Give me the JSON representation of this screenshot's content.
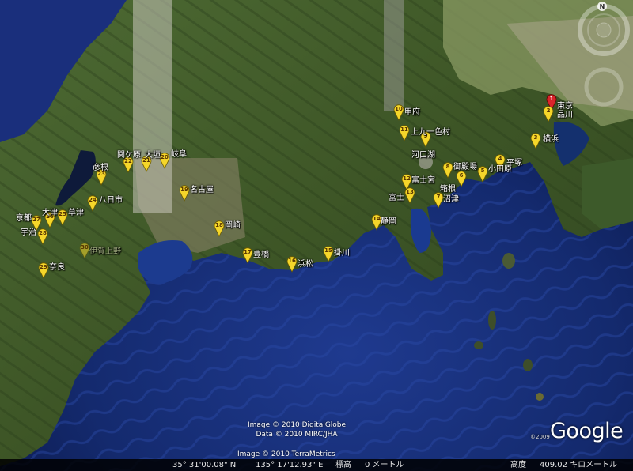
{
  "markers": [
    {
      "num": "1",
      "label": "東京",
      "color": "red"
    },
    {
      "num": "2",
      "label": "品川",
      "color": "yellow"
    },
    {
      "num": "3",
      "label": "横浜",
      "color": "yellow"
    },
    {
      "num": "4",
      "label": "平塚",
      "color": "yellow"
    },
    {
      "num": "5",
      "label": "小田原",
      "color": "yellow"
    },
    {
      "num": "6",
      "label": "箱根",
      "color": "yellow"
    },
    {
      "num": "7",
      "label": "沼津",
      "color": "yellow"
    },
    {
      "num": "8",
      "label": "御殿場",
      "color": "yellow"
    },
    {
      "num": "9",
      "label": "河口湖",
      "color": "yellow"
    },
    {
      "num": "10",
      "label": "甲府",
      "color": "yellow"
    },
    {
      "num": "11",
      "label": "上九一色村",
      "color": "yellow"
    },
    {
      "num": "12",
      "label": "富士宮",
      "color": "yellow"
    },
    {
      "num": "13",
      "label": "富士",
      "color": "yellow"
    },
    {
      "num": "14",
      "label": "静岡",
      "color": "yellow"
    },
    {
      "num": "15",
      "label": "掛川",
      "color": "yellow"
    },
    {
      "num": "16",
      "label": "浜松",
      "color": "yellow"
    },
    {
      "num": "17",
      "label": "豊橋",
      "color": "yellow"
    },
    {
      "num": "18",
      "label": "岡崎",
      "color": "yellow"
    },
    {
      "num": "19",
      "label": "名古屋",
      "color": "yellow"
    },
    {
      "num": "20",
      "label": "岐阜",
      "color": "yellow"
    },
    {
      "num": "21",
      "label": "大垣",
      "color": "yellow"
    },
    {
      "num": "22",
      "label": "関ケ原",
      "color": "yellow"
    },
    {
      "num": "23",
      "label": "彦根",
      "color": "yellow"
    },
    {
      "num": "24",
      "label": "八日市",
      "color": "yellow"
    },
    {
      "num": "25",
      "label": "草津",
      "color": "yellow"
    },
    {
      "num": "26",
      "label": "大津",
      "color": "yellow"
    },
    {
      "num": "27",
      "label": "京都",
      "color": "yellow"
    },
    {
      "num": "28",
      "label": "宇治",
      "color": "yellow"
    },
    {
      "num": "29",
      "label": "奈良",
      "color": "yellow"
    },
    {
      "num": "30",
      "label": "伊賀上野",
      "color": "yellow"
    }
  ],
  "credits": [
    "Image © 2010 DigitalGlobe",
    "Data © 2010 MIRC/JHA",
    "Image © 2010 TerraMetrics"
  ],
  "status": {
    "lat": "35° 31'00.08\" N",
    "lon": "135° 17'12.93\" E",
    "elev_label": "標高",
    "elev_value": "0 メートル",
    "alt_label": "高度",
    "alt_value": "409.02 キロメートル"
  },
  "logo": "Google",
  "copyright_year": "©2009",
  "compass_n": "N",
  "colors": {
    "ocean": "#1c2f7a",
    "deep_ocean": "#0b1a4a",
    "land": "#3f5a2a",
    "pin_yellow": "#f5d62a",
    "pin_red": "#d9252b"
  }
}
